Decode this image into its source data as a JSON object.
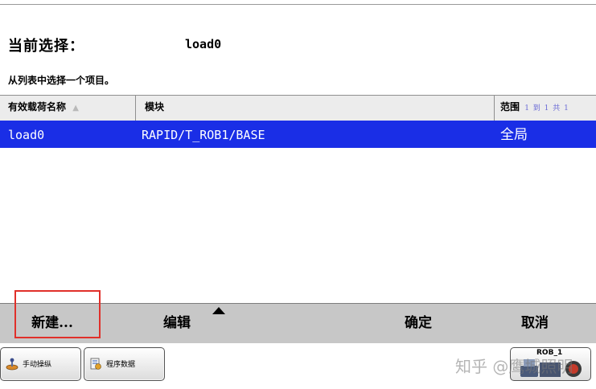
{
  "selection": {
    "current_label": "当前选择：",
    "current_value": "load0",
    "instruction": "从列表中选择一个项目。"
  },
  "table": {
    "headers": {
      "name": "有效载荷名称",
      "module": "模块",
      "scope": "范围",
      "range": "1 到 1 共 1"
    },
    "rows": [
      {
        "name": "load0",
        "module": "RAPID/T_ROB1/BASE",
        "scope": "全局"
      }
    ]
  },
  "buttons": {
    "new": "新建...",
    "edit": "编辑",
    "ok": "确定",
    "cancel": "取消"
  },
  "taskbar": {
    "manual_jog": "手动操纵",
    "program_data": "程序数据",
    "robot": "ROB_1"
  },
  "watermark": "知乎 @鹰城照明",
  "colors": {
    "selected_row": "#1a2ee6",
    "highlight_box": "#e0302a",
    "button_bar": "#c7c7c7"
  }
}
